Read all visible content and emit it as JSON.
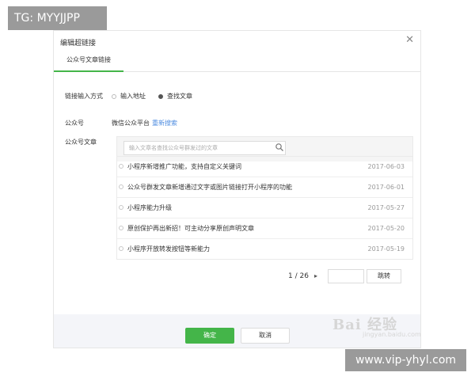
{
  "watermarks": {
    "top_left": "TG: MYYJJPP",
    "bottom_right": "www.vip-yhyl.com",
    "baidu": "Bai 经验",
    "baidu_sub": "jingyan.baidu.com"
  },
  "dialog": {
    "title": "编辑超链接",
    "close_glyph": "✕",
    "tab_label": "公众号文章链接",
    "input_method": {
      "label": "链接输入方式",
      "options": [
        {
          "label": "输入地址",
          "selected": false
        },
        {
          "label": "查找文章",
          "selected": true
        }
      ]
    },
    "account": {
      "label": "公众号",
      "name": "微信公众平台",
      "reselect": "重新搜索"
    },
    "articles": {
      "label": "公众号文章",
      "search_placeholder": "输入文章名查找公众号群发过的文章",
      "items": [
        {
          "title": "小程序新增推广功能，支持自定义关键词",
          "date": "2017-06-03"
        },
        {
          "title": "公众号群发文章新增通过文字或图片链接打开小程序的功能",
          "date": "2017-06-01"
        },
        {
          "title": "小程序能力升级",
          "date": "2017-05-27"
        },
        {
          "title": "原创保护再出新招！可主动分享原创声明文章",
          "date": "2017-05-20"
        },
        {
          "title": "小程序开放转发按钮等新能力",
          "date": "2017-05-19"
        }
      ]
    },
    "pagination": {
      "text": "1 / 26",
      "next_glyph": "▸",
      "jump_label": "跳转"
    },
    "buttons": {
      "ok": "确定",
      "cancel": "取消"
    },
    "colors": {
      "accent": "#44b549",
      "link": "#4f8de0"
    }
  }
}
